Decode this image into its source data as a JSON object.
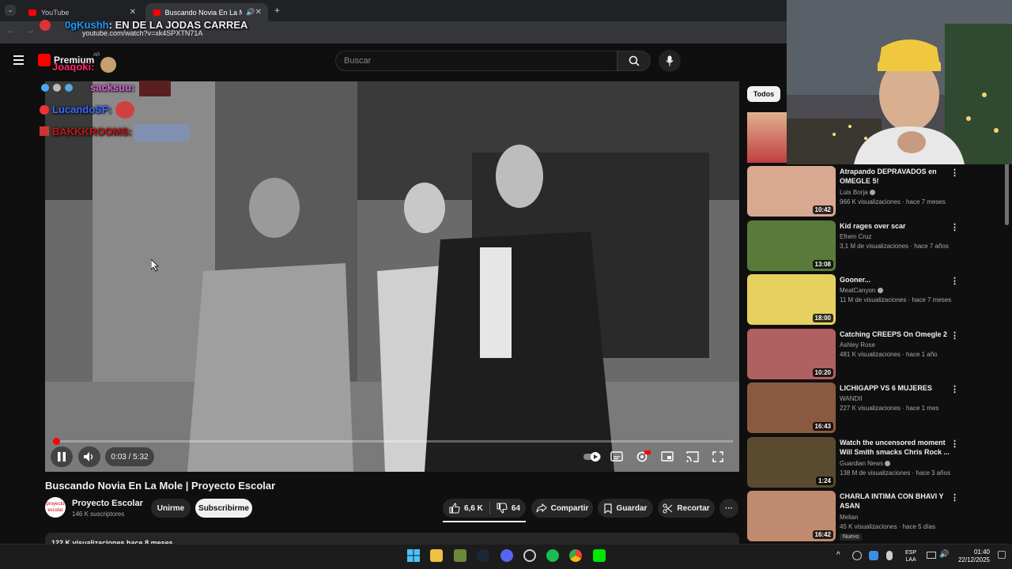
{
  "browser": {
    "tabs": [
      {
        "label": "YouTube",
        "active": false
      },
      {
        "label": "Buscando Novia En La Mole",
        "active": true
      }
    ],
    "url": "youtube.com/watch?v=xk4SPXTN71A"
  },
  "header": {
    "premium_label": "Premium",
    "premium_region": "AR",
    "search_placeholder": "Buscar"
  },
  "player": {
    "time": "0:03 / 5:32",
    "progress_fraction": 0.009
  },
  "video_info": {
    "title": "Buscando Novia En La Mole | Proyecto Escolar",
    "channel_name": "Proyecto Escolar",
    "channel_logo_text": "proyecto escolar",
    "subscribers": "146 K suscriptores",
    "join_label": "Unirme",
    "subscribe_label": "Subscribirme",
    "likes": "6,6 K",
    "dislikes": "64",
    "share_label": "Compartir",
    "save_label": "Guardar",
    "clip_label": "Recortar",
    "description_preview": "122 K visualizaciones  hace 8 meses"
  },
  "sidebar": {
    "filter_chip": "Todos",
    "recommendations": [
      {
        "title": "Atrapando DEPRAVADOS en OMEGLE 5!",
        "channel": "Luis Borja",
        "verified": true,
        "meta": "966 K visualizaciones · hace 7 meses",
        "duration": "10:42",
        "thumb_color": "#d8a890"
      },
      {
        "title": "Kid rages over scar",
        "channel": "Efrem Cruz",
        "verified": false,
        "meta": "3,1 M de visualizaciones · hace 7 años",
        "duration": "13:08",
        "thumb_color": "#5a7a3a"
      },
      {
        "title": "Gooner...",
        "channel": "MeatCanyon",
        "verified": true,
        "meta": "11 M de visualizaciones · hace 7 meses",
        "duration": "18:00",
        "thumb_color": "#e6d060"
      },
      {
        "title": "Catching CREEPS On Omegle 2",
        "channel": "Ashley Rose",
        "verified": false,
        "meta": "481 K visualizaciones · hace 1 año",
        "duration": "10:20",
        "thumb_color": "#b06060"
      },
      {
        "title": "LICHIGAPP VS 6 MUJERES",
        "channel": "WANDII",
        "verified": false,
        "meta": "227 K visualizaciones · hace 1 mes",
        "duration": "16:43",
        "thumb_color": "#8a5a40"
      },
      {
        "title": "Watch the uncensored moment Will Smith smacks Chris Rock ...",
        "channel": "Guardian News",
        "verified": true,
        "meta": "138 M de visualizaciones · hace 3 años",
        "duration": "1:24",
        "thumb_color": "#5a4a30"
      },
      {
        "title": "CHARLA INTIMA CON BHAVI Y ASAN",
        "channel": "Melian",
        "verified": false,
        "meta": "45 K visualizaciones · hace 5 días",
        "duration": "16:42",
        "thumb_color": "#c08a70",
        "badge": "Nuevo"
      }
    ]
  },
  "chat_overlay": [
    {
      "user": "0gKushh",
      "message": "EN DE LA JODAS CARREA",
      "color": "#1e9bff"
    },
    {
      "user": "Joaqoki",
      "message": "",
      "color": "#ff2a6a"
    },
    {
      "user": "sacksuu",
      "message": "",
      "color": "#e060e0"
    },
    {
      "user": "LucandoSF",
      "message": "",
      "color": "#3a6aff"
    },
    {
      "user": "BAKKKROOMS",
      "message": "",
      "color": "#c01818"
    }
  ],
  "taskbar": {
    "lang_top": "ESP",
    "lang_bottom": "LAA",
    "time": "01:40",
    "date": "22/12/2025"
  },
  "colors": {
    "accent": "#ff0000",
    "background": "#0f0f0f"
  }
}
